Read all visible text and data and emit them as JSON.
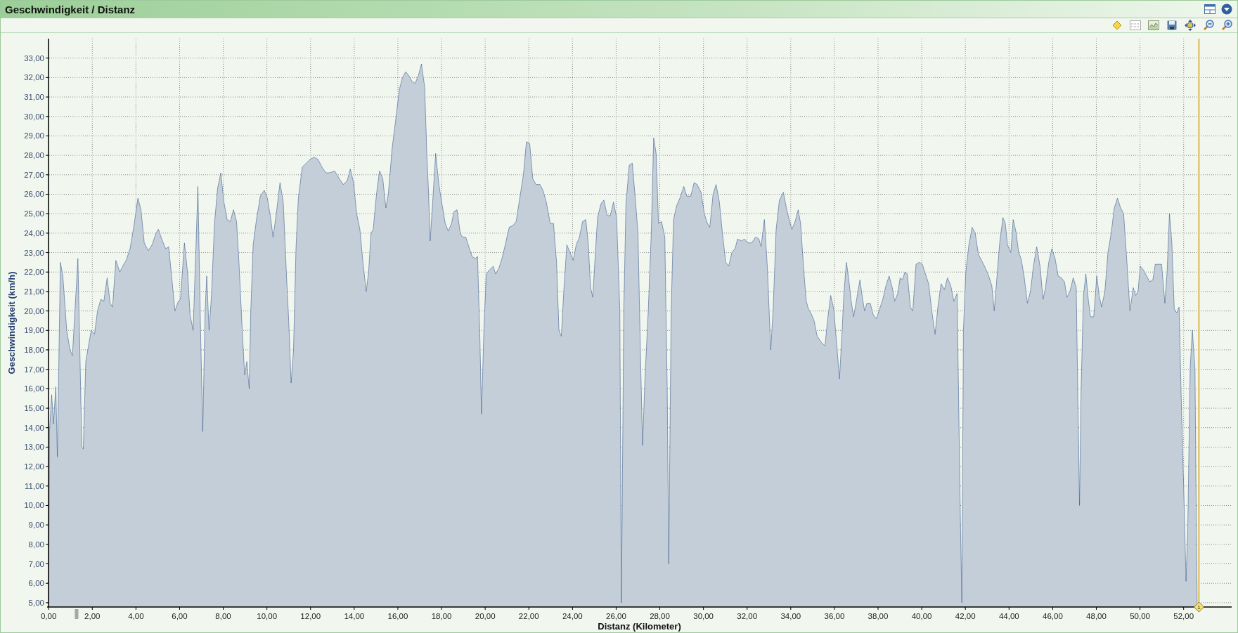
{
  "panel": {
    "title": "Geschwindigkeit / Distanz"
  },
  "chart": {
    "chart_data": {
      "type": "area",
      "xlabel": "Distanz (Kilometer)",
      "ylabel": "Geschwindigkeit (km/h)",
      "xlim": [
        -0.07,
        54.2
      ],
      "ylim": [
        4.78,
        34.0
      ],
      "x": [
        0,
        0.04,
        0.14,
        0.22,
        0.33,
        0.4,
        0.54,
        0.65,
        0.83,
        0.98,
        1.09,
        1.23,
        1.34,
        1.41,
        1.52,
        1.59,
        1.7,
        1.81,
        1.95,
        2.1,
        2.24,
        2.39,
        2.53,
        2.68,
        2.82,
        2.93,
        3.08,
        3.26,
        3.44,
        3.55,
        3.73,
        3.91,
        4.09,
        4.23,
        4.38,
        4.56,
        4.74,
        4.92,
        5.03,
        5.18,
        5.36,
        5.5,
        5.65,
        5.79,
        5.94,
        6.04,
        6.22,
        6.37,
        6.48,
        6.62,
        6.73,
        6.84,
        6.95,
        7.06,
        7.17,
        7.24,
        7.35,
        7.46,
        7.6,
        7.74,
        7.89,
        8.03,
        8.18,
        8.32,
        8.47,
        8.61,
        8.72,
        8.87,
        8.98,
        9.08,
        9.19,
        9.26,
        9.37,
        9.52,
        9.7,
        9.88,
        10.02,
        10.17,
        10.28,
        10.42,
        10.6,
        10.75,
        10.89,
        11.0,
        11.11,
        11.22,
        11.33,
        11.44,
        11.62,
        11.8,
        11.98,
        12.16,
        12.34,
        12.52,
        12.7,
        12.88,
        13.1,
        13.32,
        13.5,
        13.68,
        13.82,
        13.97,
        14.11,
        14.26,
        14.4,
        14.55,
        14.66,
        14.77,
        14.87,
        15.02,
        15.16,
        15.31,
        15.45,
        15.56,
        15.74,
        15.92,
        16.07,
        16.21,
        16.36,
        16.5,
        16.65,
        16.79,
        16.94,
        17.08,
        17.23,
        17.33,
        17.41,
        17.48,
        17.59,
        17.73,
        17.88,
        18.02,
        18.17,
        18.31,
        18.46,
        18.57,
        18.71,
        18.86,
        18.96,
        19.11,
        19.25,
        19.4,
        19.54,
        19.65,
        19.76,
        19.83,
        19.94,
        20.05,
        20.19,
        20.37,
        20.48,
        20.63,
        20.77,
        20.92,
        21.1,
        21.28,
        21.42,
        21.57,
        21.75,
        21.89,
        22.04,
        22.18,
        22.33,
        22.51,
        22.65,
        22.8,
        22.98,
        23.13,
        23.27,
        23.38,
        23.49,
        23.6,
        23.74,
        23.89,
        24.03,
        24.17,
        24.32,
        24.46,
        24.61,
        24.72,
        24.83,
        24.93,
        25.04,
        25.15,
        25.3,
        25.44,
        25.59,
        25.73,
        25.88,
        26.02,
        26.17,
        26.24,
        26.35,
        26.45,
        26.6,
        26.74,
        26.89,
        27.0,
        27.11,
        27.21,
        27.32,
        27.47,
        27.61,
        27.72,
        27.83,
        27.94,
        28.08,
        28.23,
        28.34,
        28.41,
        28.52,
        28.63,
        28.77,
        28.92,
        29.1,
        29.24,
        29.42,
        29.57,
        29.71,
        29.89,
        30.04,
        30.18,
        30.29,
        30.44,
        30.58,
        30.73,
        30.87,
        31.02,
        31.16,
        31.3,
        31.45,
        31.56,
        31.74,
        31.88,
        32.03,
        32.21,
        32.39,
        32.54,
        32.64,
        32.79,
        32.93,
        33.08,
        33.19,
        33.33,
        33.48,
        33.66,
        33.8,
        33.95,
        34.05,
        34.2,
        34.34,
        34.45,
        34.6,
        34.71,
        34.81,
        34.92,
        35.07,
        35.21,
        35.39,
        35.57,
        35.68,
        35.83,
        35.97,
        36.12,
        36.23,
        36.33,
        36.44,
        36.55,
        36.66,
        36.77,
        36.88,
        37.02,
        37.17,
        37.28,
        37.38,
        37.49,
        37.64,
        37.78,
        37.93,
        38.07,
        38.22,
        38.36,
        38.51,
        38.65,
        38.76,
        38.9,
        39.01,
        39.12,
        39.23,
        39.34,
        39.48,
        39.59,
        39.74,
        39.88,
        40.03,
        40.17,
        40.32,
        40.46,
        40.61,
        40.75,
        40.89,
        41.04,
        41.18,
        41.33,
        41.47,
        41.62,
        41.76,
        41.84,
        41.91,
        42.02,
        42.16,
        42.31,
        42.45,
        42.6,
        42.74,
        42.92,
        43.07,
        43.21,
        43.32,
        43.43,
        43.57,
        43.72,
        43.83,
        43.93,
        44.08,
        44.19,
        44.33,
        44.44,
        44.55,
        44.69,
        44.84,
        44.98,
        45.13,
        45.27,
        45.42,
        45.56,
        45.67,
        45.82,
        45.96,
        46.11,
        46.25,
        46.4,
        46.54,
        46.65,
        46.79,
        46.94,
        47.08,
        47.16,
        47.23,
        47.3,
        47.41,
        47.52,
        47.63,
        47.73,
        47.88,
        48.02,
        48.13,
        48.24,
        48.39,
        48.53,
        48.68,
        48.82,
        48.97,
        49.11,
        49.25,
        49.4,
        49.54,
        49.69,
        49.8,
        49.91,
        50.01,
        50.16,
        50.3,
        50.45,
        50.59,
        50.7,
        50.85,
        50.99,
        51.14,
        51.24,
        51.35,
        51.46,
        51.57,
        51.68,
        51.79,
        51.9,
        52.0,
        52.11,
        52.19,
        52.3,
        52.4,
        52.52,
        52.59,
        52.62
      ],
      "values": [
        5,
        13.8,
        15.7,
        14.2,
        16.1,
        12.5,
        22.5,
        21.8,
        19,
        18,
        17.7,
        20.5,
        22.7,
        19,
        13,
        12.9,
        17.4,
        18.1,
        19,
        18.8,
        20,
        20.6,
        20.5,
        21.7,
        20.4,
        20.2,
        22.6,
        22,
        22.4,
        22.6,
        23.2,
        24.4,
        25.8,
        25.2,
        23.5,
        23.1,
        23.4,
        24,
        24.2,
        23.7,
        23.2,
        23.3,
        21.6,
        20,
        20.5,
        20.6,
        23.5,
        21.9,
        19.8,
        19,
        22.6,
        26.4,
        19.5,
        13.8,
        20,
        21.8,
        19,
        20.8,
        24.5,
        26.3,
        27.1,
        25.6,
        24.7,
        24.6,
        25.2,
        24.6,
        22.5,
        19,
        16.7,
        17.4,
        16,
        20,
        23.4,
        24.7,
        25.9,
        26.2,
        25.8,
        24.8,
        23.8,
        24.9,
        26.6,
        25.6,
        22,
        19.5,
        16.3,
        18,
        23.2,
        25.8,
        27.4,
        27.6,
        27.8,
        27.9,
        27.8,
        27.4,
        27.1,
        27.1,
        27.2,
        26.8,
        26.5,
        26.7,
        27.3,
        26.6,
        25,
        24.2,
        22.5,
        21,
        22,
        24,
        24.2,
        26,
        27.2,
        26.8,
        25.3,
        26,
        28.4,
        30,
        31.4,
        32,
        32.3,
        32.1,
        31.8,
        31.7,
        32.1,
        32.7,
        31.5,
        28,
        26,
        23.6,
        25.5,
        28.1,
        26.5,
        25.5,
        24.5,
        24.1,
        24.5,
        25.1,
        25.2,
        24,
        23.8,
        23.8,
        23.3,
        22.8,
        22.7,
        22.8,
        18.5,
        14.7,
        19,
        21.9,
        22.1,
        22.3,
        21.9,
        22.2,
        22.7,
        23.4,
        24.3,
        24.4,
        24.6,
        25.7,
        27,
        28.7,
        28.6,
        26.8,
        26.5,
        26.5,
        26.2,
        25.6,
        24.5,
        24.5,
        22.5,
        19,
        18.7,
        21,
        23.4,
        23,
        22.6,
        23.4,
        23.8,
        24.6,
        24.7,
        23.5,
        21.2,
        20.7,
        22.8,
        24.8,
        25.5,
        25.7,
        24.9,
        24.9,
        25.6,
        24.8,
        20,
        5,
        20,
        25.5,
        27.5,
        27.6,
        25.6,
        24,
        18,
        13.1,
        16.5,
        20,
        24,
        28.9,
        28.1,
        24.5,
        24.6,
        23.8,
        16,
        7,
        20,
        24.7,
        25.4,
        25.8,
        26.4,
        25.9,
        25.9,
        26.6,
        26.5,
        26.1,
        25,
        24.5,
        24.3,
        26,
        26.5,
        25.6,
        24,
        22.5,
        22.3,
        23,
        23.2,
        23.7,
        23.6,
        23.7,
        23.5,
        23.5,
        23.8,
        23.7,
        23.3,
        24.7,
        22.2,
        18,
        20,
        24.2,
        25.7,
        26.1,
        25.3,
        24.6,
        24.2,
        24.6,
        25.2,
        24.5,
        22,
        20.5,
        20.1,
        19.9,
        19.5,
        18.7,
        18.4,
        18.2,
        19.5,
        20.8,
        20.1,
        18.1,
        16.5,
        18.5,
        21,
        22.5,
        21.6,
        20.5,
        19.7,
        20.6,
        21.6,
        20.7,
        20,
        20.4,
        20.4,
        19.8,
        19.6,
        20.1,
        20.6,
        21.3,
        21.8,
        21.2,
        20.5,
        20.9,
        21.7,
        21.6,
        22,
        21.9,
        20.2,
        20,
        22.4,
        22.5,
        22.4,
        21.9,
        21.4,
        20,
        18.8,
        20.3,
        21.4,
        21.1,
        21.7,
        21.3,
        20.5,
        20.9,
        10,
        5,
        19,
        22,
        23.4,
        24.3,
        24,
        22.9,
        22.6,
        22.2,
        21.8,
        21.3,
        20,
        21.5,
        23.5,
        24.8,
        24.5,
        23.4,
        23,
        24.7,
        24,
        23,
        22.7,
        21.8,
        20.4,
        21,
        22.4,
        23.3,
        22.3,
        20.6,
        21.2,
        22.5,
        23.2,
        22.7,
        21.8,
        21.7,
        21.5,
        20.7,
        21,
        21.7,
        21.2,
        15,
        10,
        16,
        20.8,
        21.9,
        20.6,
        19.7,
        19.7,
        21.8,
        20.8,
        20.2,
        21,
        23,
        24,
        25.3,
        25.8,
        25.3,
        25,
        22.5,
        20,
        21.2,
        20.8,
        21,
        22.3,
        22.1,
        21.8,
        21.5,
        21.6,
        22.4,
        22.4,
        22.4,
        20.4,
        22,
        25,
        23.5,
        20.1,
        19.9,
        20.2,
        15,
        11,
        6.1,
        9,
        17.1,
        19,
        17,
        8,
        5
      ],
      "xticks": [
        {
          "value": 0,
          "label": "0,00"
        },
        {
          "value": 2,
          "label": "2,00"
        },
        {
          "value": 4,
          "label": "4,00"
        },
        {
          "value": 6,
          "label": "6,00"
        },
        {
          "value": 8,
          "label": "8,00"
        },
        {
          "value": 10,
          "label": "10,00"
        },
        {
          "value": 12,
          "label": "12,00"
        },
        {
          "value": 14,
          "label": "14,00"
        },
        {
          "value": 16,
          "label": "16,00"
        },
        {
          "value": 18,
          "label": "18,00"
        },
        {
          "value": 20,
          "label": "20,00"
        },
        {
          "value": 22,
          "label": "22,00"
        },
        {
          "value": 24,
          "label": "24,00"
        },
        {
          "value": 26,
          "label": "26,00"
        },
        {
          "value": 28,
          "label": "28,00"
        },
        {
          "value": 30,
          "label": "30,00"
        },
        {
          "value": 32,
          "label": "32,00"
        },
        {
          "value": 34,
          "label": "34,00"
        },
        {
          "value": 36,
          "label": "36,00"
        },
        {
          "value": 38,
          "label": "38,00"
        },
        {
          "value": 40,
          "label": "40,00"
        },
        {
          "value": 42,
          "label": "42,00"
        },
        {
          "value": 44,
          "label": "44,00"
        },
        {
          "value": 46,
          "label": "46,00"
        },
        {
          "value": 48,
          "label": "48,00"
        },
        {
          "value": 50,
          "label": "50,00"
        },
        {
          "value": 52,
          "label": "52,00"
        }
      ],
      "yticks": [
        {
          "value": 5,
          "label": "5,00"
        },
        {
          "value": 6,
          "label": "6,00"
        },
        {
          "value": 7,
          "label": "7,00"
        },
        {
          "value": 8,
          "label": "8,00"
        },
        {
          "value": 9,
          "label": "9,00"
        },
        {
          "value": 10,
          "label": "10,00"
        },
        {
          "value": 11,
          "label": "11,00"
        },
        {
          "value": 12,
          "label": "12,00"
        },
        {
          "value": 13,
          "label": "13,00"
        },
        {
          "value": 14,
          "label": "14,00"
        },
        {
          "value": 15,
          "label": "15,00"
        },
        {
          "value": 16,
          "label": "16,00"
        },
        {
          "value": 17,
          "label": "17,00"
        },
        {
          "value": 18,
          "label": "18,00"
        },
        {
          "value": 19,
          "label": "19,00"
        },
        {
          "value": 20,
          "label": "20,00"
        },
        {
          "value": 21,
          "label": "21,00"
        },
        {
          "value": 22,
          "label": "22,00"
        },
        {
          "value": 23,
          "label": "23,00"
        },
        {
          "value": 24,
          "label": "24,00"
        },
        {
          "value": 25,
          "label": "25,00"
        },
        {
          "value": 26,
          "label": "26,00"
        },
        {
          "value": 27,
          "label": "27,00"
        },
        {
          "value": 28,
          "label": "28,00"
        },
        {
          "value": 29,
          "label": "29,00"
        },
        {
          "value": 30,
          "label": "30,00"
        },
        {
          "value": 31,
          "label": "31,00"
        },
        {
          "value": 32,
          "label": "32,00"
        },
        {
          "value": 33,
          "label": "33,00"
        }
      ],
      "grid": true,
      "ref_lines": [
        {
          "axis": "x",
          "value": 52.7
        }
      ],
      "annotations": [
        {
          "x": 52.7,
          "y": 4.78,
          "text": "1"
        }
      ]
    }
  }
}
